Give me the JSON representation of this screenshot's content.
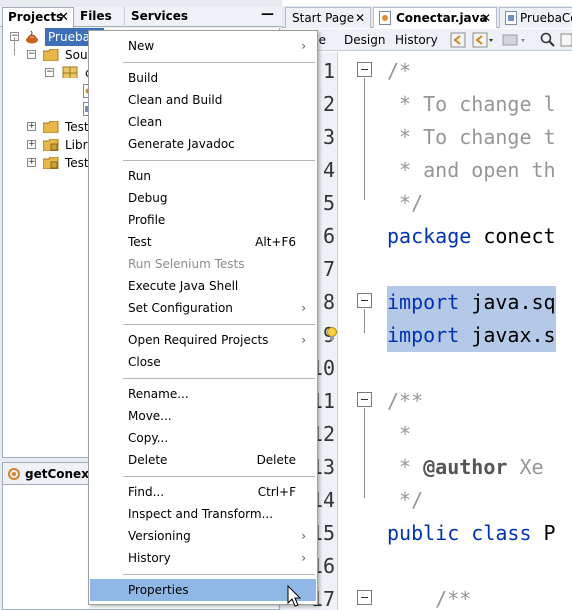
{
  "left_tabs": {
    "projects": "Projects",
    "files": "Files",
    "services": "Services",
    "close": "✕",
    "minimize": "—"
  },
  "tree": {
    "rows": [
      {
        "label": "PruebaJa",
        "selected": true
      },
      {
        "label": "Sour"
      },
      {
        "label": "c"
      },
      {
        "label": ""
      },
      {
        "label": ""
      },
      {
        "label": "Test"
      },
      {
        "label": "Libra"
      },
      {
        "label": "Test"
      }
    ]
  },
  "navigator": {
    "title": "getConexio"
  },
  "editor": {
    "tabs": [
      {
        "label": "Start Page",
        "close": "✕"
      },
      {
        "label": "Conectar.java",
        "close": "✕"
      },
      {
        "label": "PruebaCon"
      }
    ],
    "toolbar": {
      "source": "ce",
      "design": "Design",
      "history": "History"
    },
    "line_numbers": [
      "1",
      "2",
      "3",
      "4",
      "5",
      "6",
      "7",
      "8",
      "9",
      "10",
      "11",
      "12",
      "13",
      "14",
      "15",
      "16",
      "17"
    ],
    "code": [
      {
        "a": "/*",
        "b": ""
      },
      {
        "a": " * To change l",
        "b": ""
      },
      {
        "a": " * To change t",
        "b": ""
      },
      {
        "a": " * and open th",
        "b": ""
      },
      {
        "a": " */",
        "b": ""
      },
      {
        "a": "package",
        "b": " conect"
      },
      {
        "a": "",
        "b": ""
      },
      {
        "a": "import",
        "b": " java.sq"
      },
      {
        "a": "import",
        "b": " javax.s"
      },
      {
        "a": "",
        "b": ""
      },
      {
        "a": "/**",
        "b": ""
      },
      {
        "a": " *",
        "b": ""
      },
      {
        "a": " * ",
        "b": "@author",
        "c": " Xe"
      },
      {
        "a": " */",
        "b": ""
      },
      {
        "a": "public class",
        "b": " P"
      },
      {
        "a": "",
        "b": ""
      },
      {
        "a": "    /**",
        "b": ""
      }
    ]
  },
  "context_menu": {
    "items": [
      {
        "label": "New",
        "submenu": true
      },
      {
        "separator": true
      },
      {
        "label": "Build"
      },
      {
        "label": "Clean and Build"
      },
      {
        "label": "Clean"
      },
      {
        "label": "Generate Javadoc"
      },
      {
        "separator": true
      },
      {
        "label": "Run"
      },
      {
        "label": "Debug"
      },
      {
        "label": "Profile"
      },
      {
        "label": "Test",
        "shortcut": "Alt+F6"
      },
      {
        "label": "Run Selenium Tests",
        "disabled": true
      },
      {
        "label": "Execute Java Shell"
      },
      {
        "label": "Set Configuration",
        "submenu": true
      },
      {
        "separator": true
      },
      {
        "label": "Open Required Projects",
        "submenu": true
      },
      {
        "label": "Close"
      },
      {
        "separator": true
      },
      {
        "label": "Rename..."
      },
      {
        "label": "Move..."
      },
      {
        "label": "Copy..."
      },
      {
        "label": "Delete",
        "shortcut": "Delete"
      },
      {
        "separator": true
      },
      {
        "label": "Find...",
        "shortcut": "Ctrl+F"
      },
      {
        "label": "Inspect and Transform..."
      },
      {
        "label": "Versioning",
        "submenu": true
      },
      {
        "label": "History",
        "submenu": true
      },
      {
        "separator": true
      },
      {
        "label": "Properties",
        "hover": true
      }
    ],
    "submenu_arrow": "›"
  },
  "colors": {
    "selection": "#3d70b8",
    "menu_hover": "#8fb8e6",
    "keyword": "#0033b3",
    "comment": "#969696",
    "code_selection": "#b4c9e8"
  }
}
